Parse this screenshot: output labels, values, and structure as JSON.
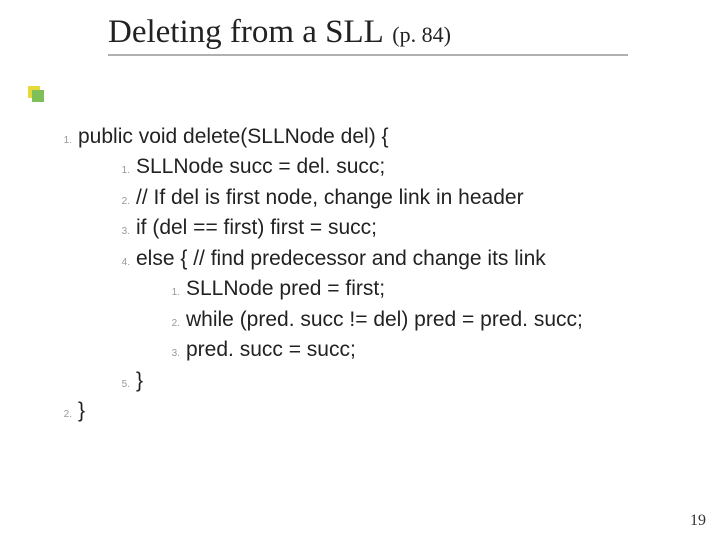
{
  "title": {
    "main": "Deleting from a SLL",
    "sub": "(p. 84)"
  },
  "code": {
    "l1": "public void delete(SLLNode del) {",
    "l2": "SLLNode succ = del. succ;",
    "l3": "// If del is first node, change link in header",
    "l4": "if (del == first) first = succ;",
    "l5": "else { // find predecessor and change its link",
    "l6": "SLLNode pred = first;",
    "l7": "while (pred. succ != del) pred = pred. succ;",
    "l8": "pred. succ = succ;",
    "l9": "}",
    "l10": "}"
  },
  "numbers": {
    "n1": "1.",
    "n2": "1.",
    "n3": "2.",
    "n4": "3.",
    "n5": "4.",
    "n6": "1.",
    "n7": "2.",
    "n8": "3.",
    "n9": "5.",
    "n10": "2."
  },
  "page": "19"
}
